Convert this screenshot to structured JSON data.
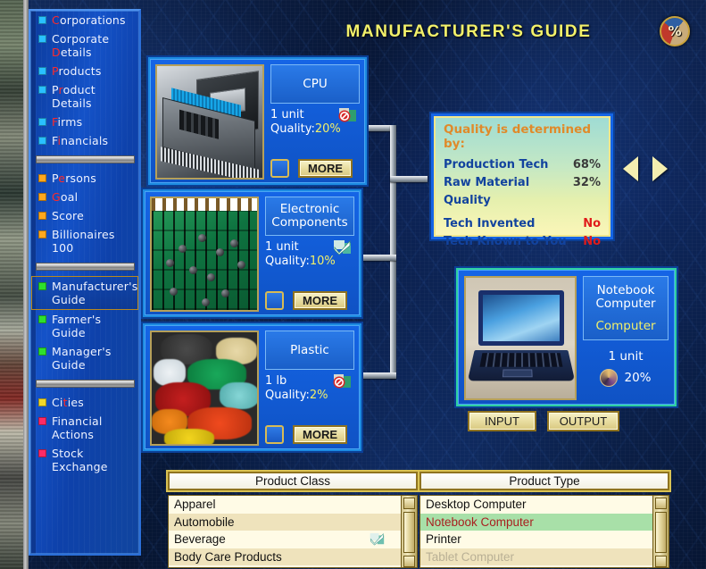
{
  "header": {
    "title": "MANUFACTURER'S GUIDE",
    "percent_icon": "%",
    "percent_icon_name": "percent-pie-icon"
  },
  "sidebar": {
    "items": [
      {
        "label": "Corporations",
        "hotkey": "C",
        "bullet": "#29c0ff",
        "selected": false,
        "type": "item"
      },
      {
        "label": "Corporate Details",
        "hotkey": "D",
        "bullet": "#29c0ff",
        "selected": false,
        "type": "item"
      },
      {
        "label": "Products",
        "hotkey": "P",
        "bullet": "#29c0ff",
        "selected": false,
        "type": "item"
      },
      {
        "label": "Product Details",
        "hotkey": "r",
        "bullet": "#29c0ff",
        "selected": false,
        "type": "item"
      },
      {
        "label": "Firms",
        "hotkey": "F",
        "bullet": "#29c0ff",
        "selected": false,
        "type": "item"
      },
      {
        "label": "Financials",
        "hotkey": "i",
        "bullet": "#29c0ff",
        "selected": false,
        "type": "item"
      },
      {
        "type": "separator"
      },
      {
        "label": "Persons",
        "hotkey": "e",
        "bullet": "#ffa81e",
        "selected": false,
        "type": "item"
      },
      {
        "label": "Goal",
        "hotkey": "G",
        "bullet": "#ffa81e",
        "selected": false,
        "type": "item"
      },
      {
        "label": "Score",
        "hotkey": "",
        "bullet": "#ffa81e",
        "selected": false,
        "type": "item"
      },
      {
        "label": "Billionaires 100",
        "hotkey": "",
        "bullet": "#ffa81e",
        "selected": false,
        "type": "item"
      },
      {
        "type": "separator"
      },
      {
        "label": "Manufacturer's Guide",
        "hotkey": "",
        "bullet": "#2ee02e",
        "selected": true,
        "type": "item"
      },
      {
        "label": "Farmer's Guide",
        "hotkey": "",
        "bullet": "#2ee02e",
        "selected": false,
        "type": "item"
      },
      {
        "label": "Manager's Guide",
        "hotkey": "",
        "bullet": "#2ee02e",
        "selected": false,
        "type": "item"
      },
      {
        "type": "separator"
      },
      {
        "label": "Cities",
        "hotkey": "t",
        "bullet": "#f0d82a",
        "selected": false,
        "type": "item"
      },
      {
        "label": "Financial Actions",
        "hotkey": "",
        "bullet": "#ff2a66",
        "selected": false,
        "type": "item"
      },
      {
        "label": "Stock Exchange",
        "hotkey": "",
        "bullet": "#ff2a66",
        "selected": false,
        "type": "item"
      }
    ]
  },
  "inputs": [
    {
      "name": "CPU",
      "unit": "1 unit",
      "quality_label": "Quality:",
      "quality_value": "20%",
      "flag_icon": "no-entry-icon",
      "flag_state": "no",
      "more_label": "MORE",
      "checkbox_checked": false,
      "photo": "cpu-photo"
    },
    {
      "name": "Electronic Components",
      "unit": "1 unit",
      "quality_label": "Quality:",
      "quality_value": "10%",
      "flag_icon": "check-mark-icon",
      "flag_state": "yes",
      "more_label": "MORE",
      "checkbox_checked": false,
      "photo": "pcb-photo"
    },
    {
      "name": "Plastic",
      "unit": "1 lb",
      "quality_label": "Quality:",
      "quality_value": "2%",
      "flag_icon": "no-entry-icon",
      "flag_state": "no",
      "more_label": "MORE",
      "checkbox_checked": false,
      "photo": "plastic-photo"
    }
  ],
  "quality_box": {
    "title": "Quality is determined by:",
    "rows": [
      {
        "label": "Production Tech",
        "value": "68%",
        "kind": "num"
      },
      {
        "label": "Raw Material Quality",
        "value": "32%",
        "kind": "num"
      },
      {
        "label": "Tech Invented",
        "value": "No",
        "kind": "no"
      },
      {
        "label": "Tech Known to You",
        "value": "No",
        "kind": "no"
      }
    ]
  },
  "product": {
    "name": "Notebook Computer",
    "name_line1": "Notebook",
    "name_line2": "Computer",
    "category": "Computer",
    "unit": "1 unit",
    "quality_value": "20%",
    "avatar_icon": "quality-avatar-icon",
    "photo": "laptop-photo"
  },
  "io_buttons": {
    "input": "INPUT",
    "output": "OUTPUT"
  },
  "nav_arrows": {
    "left": "previous-arrow",
    "right": "next-arrow"
  },
  "product_class": {
    "header": "Product Class",
    "rows": [
      {
        "label": "Apparel",
        "state": "normal",
        "check": false
      },
      {
        "label": "Automobile",
        "state": "alt",
        "check": false
      },
      {
        "label": "Beverage",
        "state": "normal",
        "check": true
      },
      {
        "label": "Body Care Products",
        "state": "alt",
        "check": false
      }
    ]
  },
  "product_type": {
    "header": "Product Type",
    "rows": [
      {
        "label": "Desktop Computer",
        "state": "normal",
        "check": false
      },
      {
        "label": "Notebook Computer",
        "state": "selected",
        "check": false
      },
      {
        "label": "Printer",
        "state": "normal",
        "check": false
      },
      {
        "label": "Tablet Computer",
        "state": "dim",
        "check": false
      }
    ]
  },
  "colors": {
    "accent_title": "#f2f06a",
    "panel_blue": "#1565e6",
    "selected_row": "#a8e0a8",
    "no_red": "#e01b1b",
    "info_orange": "#e08a2a"
  }
}
